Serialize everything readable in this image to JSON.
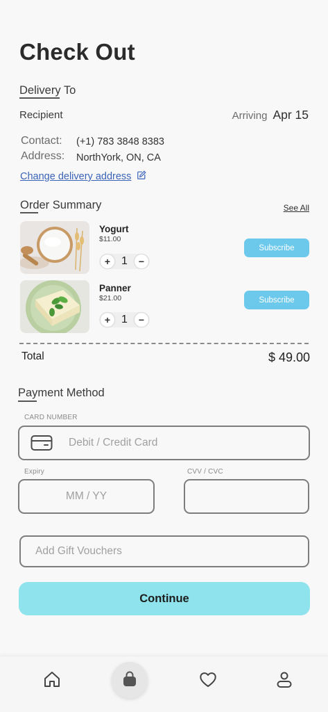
{
  "header": {
    "title": "Check Out"
  },
  "delivery": {
    "section_title": "Delivery To",
    "recipient_label": "Recipient",
    "arriving_label": "Arriving",
    "arriving_date": "Apr 15",
    "contact_label": "Contact:",
    "contact_value": "(+1) 783 3848 8383",
    "address_label": "Address:",
    "address_value": "NorthYork, ON, CA",
    "change_link": "Change delivery address"
  },
  "order": {
    "section_title": "Order Summary",
    "see_all": "See All",
    "items": [
      {
        "name": "Yogurt",
        "price": "$11.00",
        "qty": "1",
        "plus": "+",
        "minus": "−",
        "subscribe": "Subscribe"
      },
      {
        "name": "Panner",
        "price": "$21.00",
        "qty": "1",
        "plus": "+",
        "minus": "−",
        "subscribe": "Subscribe"
      }
    ],
    "total_label": "Total",
    "total_value": "$ 49.00"
  },
  "payment": {
    "section_title": "Payment Method",
    "card_label": "CARD NUMBER",
    "card_placeholder": "Debit / Credit Card",
    "expiry_label": "Expiry",
    "expiry_placeholder": "MM / YY",
    "cvv_label": "CVV / CVC",
    "cvv_placeholder": "",
    "gift_placeholder": "Add Gift  Vouchers"
  },
  "actions": {
    "continue_label": "Continue"
  },
  "nav": {
    "items": [
      {
        "icon": "home-icon"
      },
      {
        "icon": "bag-icon",
        "active": true
      },
      {
        "icon": "heart-icon"
      },
      {
        "icon": "user-icon"
      }
    ]
  },
  "colors": {
    "accent": "#8ee3ec",
    "subscribe": "#6dc9ec",
    "link": "#3a63b8",
    "background": "#f8f8f8"
  }
}
